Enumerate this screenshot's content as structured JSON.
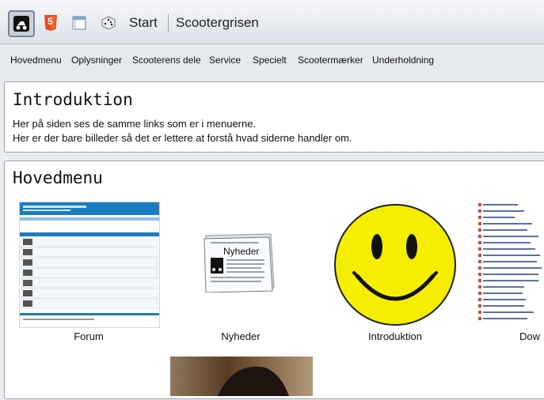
{
  "toolbar": {
    "icons": [
      "scooter-app-icon",
      "html5-icon",
      "window-icon",
      "dice-icon"
    ],
    "html5_label": "5",
    "start_label": "Start",
    "site_title": "Scootergrisen"
  },
  "menu": {
    "items": [
      "Hovedmenu",
      "Oplysninger",
      "Scooterens dele",
      "Service",
      "Specielt",
      "Scootermærker",
      "Underholdning"
    ]
  },
  "intro": {
    "heading": "Introduktion",
    "line1": "Her på siden ses de samme links som er i menuerne.",
    "line2": "Her er der bare billeder så det er lettere at forstå hvad siderne handler om."
  },
  "main": {
    "heading": "Hovedmenu",
    "cards": [
      {
        "label": "Forum"
      },
      {
        "label": "Nyheder",
        "image_text": "Nyheder"
      },
      {
        "label": "Introduktion"
      },
      {
        "label": "Dow"
      }
    ]
  },
  "colors": {
    "accent": "#1a7cc0",
    "smiley": "#f5ee00",
    "panel_border": "#9aa3ad"
  }
}
